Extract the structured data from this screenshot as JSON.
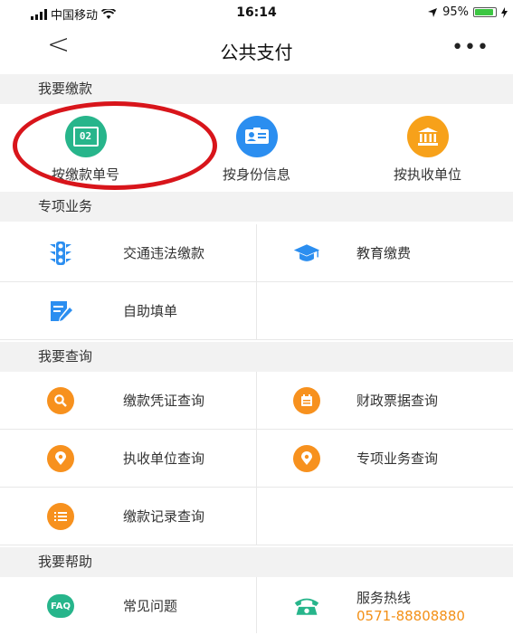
{
  "status_bar": {
    "carrier": "中国移动",
    "time": "16:14",
    "battery": "95%"
  },
  "nav": {
    "title": "公共支付",
    "back": "<",
    "more": "•••"
  },
  "sections": {
    "pay": "我要缴款",
    "special": "专项业务",
    "query": "我要查询",
    "help": "我要帮助"
  },
  "pay_options": [
    {
      "label": "按缴款单号",
      "icon": "payment-slip-number-icon",
      "icon_text": "02",
      "color": "#27b58b"
    },
    {
      "label": "按身份信息",
      "icon": "id-card-icon",
      "color": "#2b8ef0"
    },
    {
      "label": "按执收单位",
      "icon": "bank-building-icon",
      "color": "#f7a11a"
    }
  ],
  "special_items": [
    {
      "label": "交通违法缴款",
      "icon": "traffic-light-icon",
      "color": "#2b8ef0"
    },
    {
      "label": "教育缴费",
      "icon": "graduation-cap-icon",
      "color": "#2b8ef0"
    },
    {
      "label": "自助填单",
      "icon": "form-edit-icon",
      "color": "#2b8ef0"
    }
  ],
  "query_items": [
    {
      "label": "缴款凭证查询",
      "icon": "search-icon",
      "color": "#f7911e"
    },
    {
      "label": "财政票据查询",
      "icon": "receipt-icon",
      "color": "#f7911e"
    },
    {
      "label": "执收单位查询",
      "icon": "location-pin-icon",
      "color": "#f7911e"
    },
    {
      "label": "专项业务查询",
      "icon": "location-pin-icon",
      "color": "#f7911e"
    },
    {
      "label": "缴款记录查询",
      "icon": "list-icon",
      "color": "#f7911e"
    }
  ],
  "help_items": [
    {
      "label": "常见问题",
      "icon": "faq-icon",
      "icon_text": "FAQ",
      "color": "#27b58b"
    },
    {
      "label": "服务热线",
      "number": "0571-88808880",
      "icon": "telephone-icon",
      "color": "#27b58b"
    }
  ],
  "colors": {
    "accent_orange": "#f39017",
    "highlight_ring": "#d8151b"
  }
}
